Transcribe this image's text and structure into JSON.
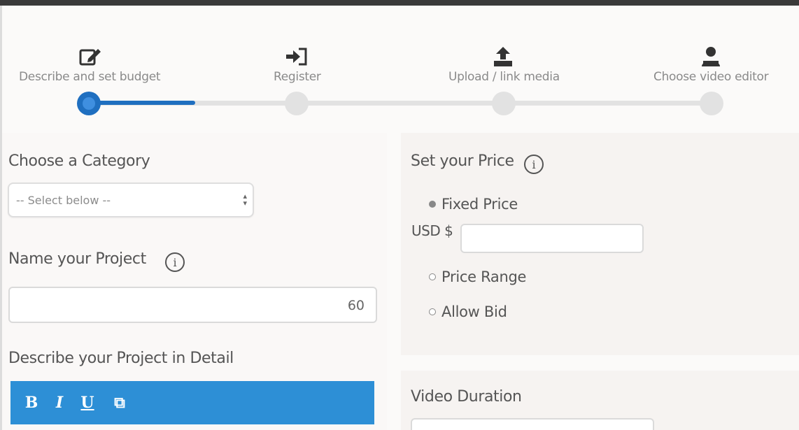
{
  "steps": [
    {
      "label": "Describe and set budget",
      "icon": "edit-icon",
      "active": true
    },
    {
      "label": "Register",
      "icon": "sign-in-icon",
      "active": false
    },
    {
      "label": "Upload / link media",
      "icon": "upload-icon",
      "active": false
    },
    {
      "label": "Choose video editor",
      "icon": "user-icon",
      "active": false
    }
  ],
  "progress": {
    "completed_fraction": 0.17
  },
  "category": {
    "label": "Choose a Category",
    "selected": "-- Select below --"
  },
  "project_name": {
    "label": "Name your Project",
    "info": "i",
    "value": "",
    "counter": "60"
  },
  "description": {
    "label": "Describe your Project in Detail",
    "toolbar": {
      "bold": "B",
      "italic": "I",
      "underline": "U",
      "paste": "⧉"
    }
  },
  "price": {
    "label": "Set your Price",
    "info": "i",
    "options": [
      "Fixed Price",
      "Price Range",
      "Allow Bid"
    ],
    "selected": "Fixed Price",
    "currency_label": "USD $",
    "amount": ""
  },
  "duration": {
    "label": "Video Duration"
  },
  "colors": {
    "accent": "#1f6fc0",
    "toolbar": "#2d8fd6",
    "track": "#e2e2e2"
  }
}
